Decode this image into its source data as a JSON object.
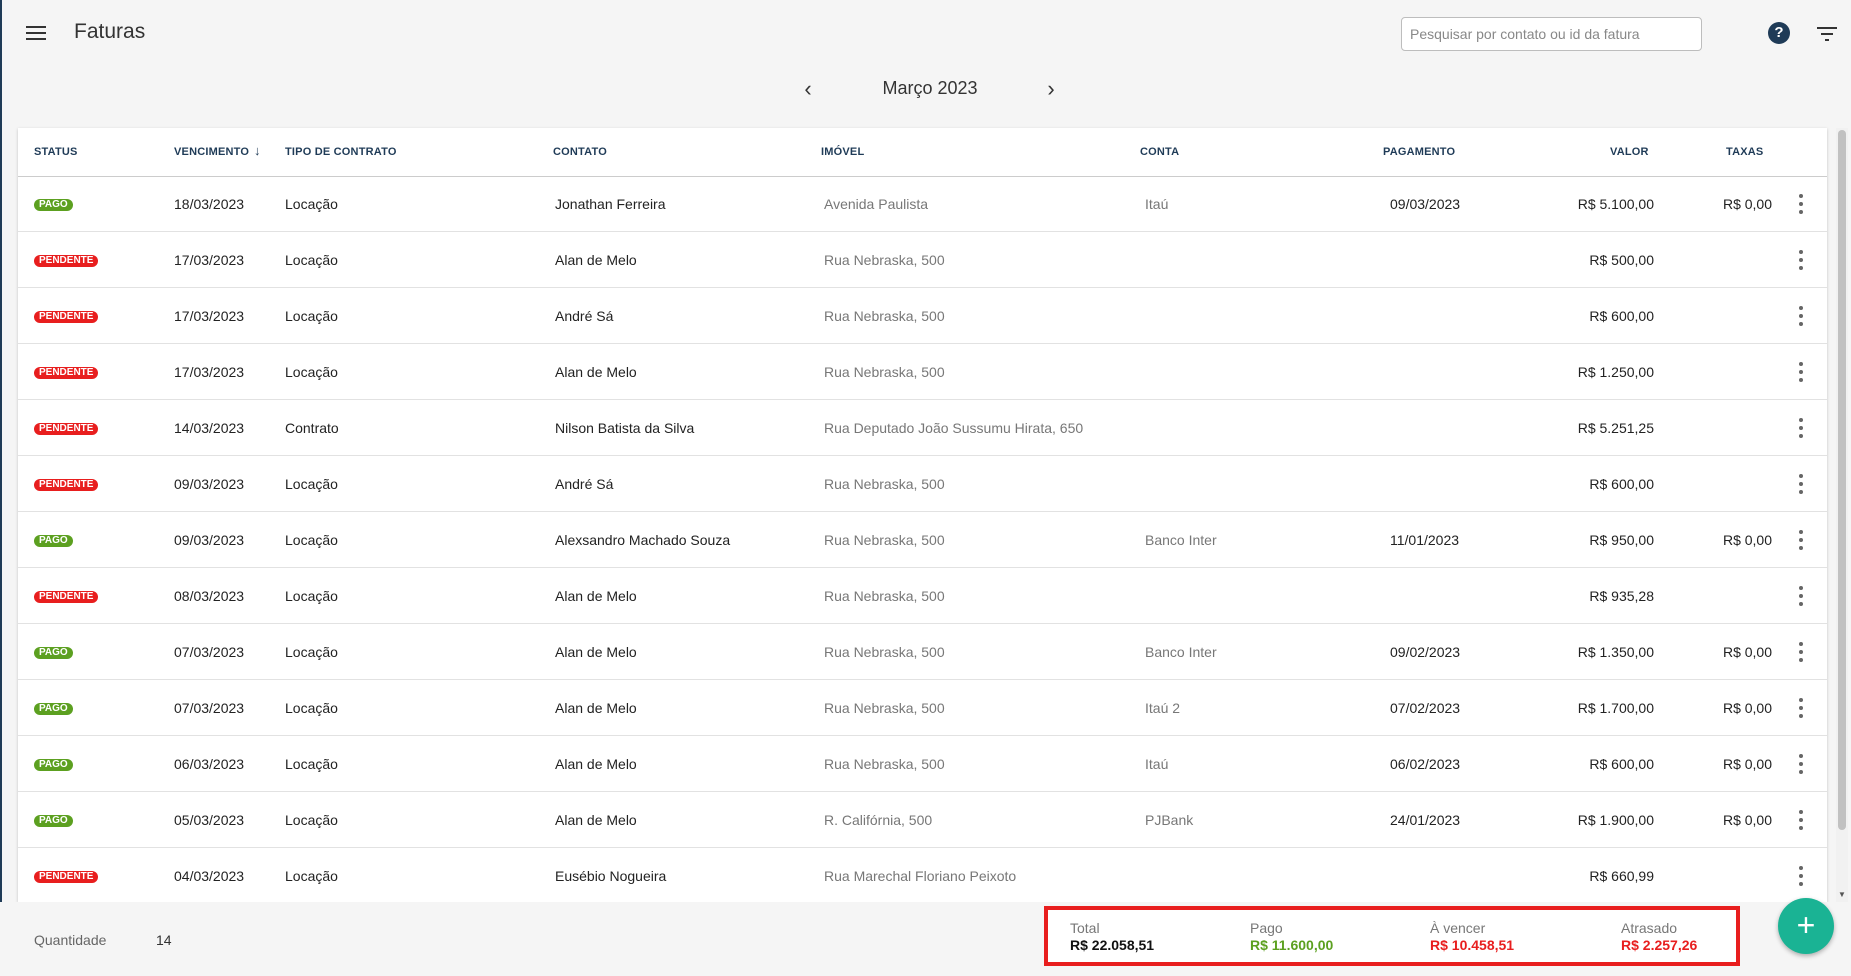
{
  "header": {
    "title": "Faturas",
    "search_placeholder": "Pesquisar por contato ou id da fatura",
    "help_icon": "help-icon",
    "filter_icon": "filter-icon"
  },
  "month_nav": {
    "label": "Março 2023",
    "prev": "‹",
    "next": "›"
  },
  "table": {
    "columns": [
      "STATUS",
      "VENCIMENTO",
      "TIPO DE CONTRATO",
      "CONTATO",
      "IMÓVEL",
      "CONTA",
      "PAGAMENTO",
      "VALOR",
      "TAXAS"
    ],
    "rows": [
      {
        "status": "PAGO",
        "vencimento": "18/03/2023",
        "tipo": "Locação",
        "contato": "Jonathan Ferreira",
        "imovel": "Avenida Paulista",
        "conta": "Itaú",
        "pagamento": "09/03/2023",
        "valor": "R$ 5.100,00",
        "taxas": "R$ 0,00"
      },
      {
        "status": "PENDENTE",
        "vencimento": "17/03/2023",
        "tipo": "Locação",
        "contato": "Alan de Melo",
        "imovel": "Rua Nebraska, 500",
        "conta": "",
        "pagamento": "",
        "valor": "R$ 500,00",
        "taxas": ""
      },
      {
        "status": "PENDENTE",
        "vencimento": "17/03/2023",
        "tipo": "Locação",
        "contato": "André Sá",
        "imovel": "Rua Nebraska, 500",
        "conta": "",
        "pagamento": "",
        "valor": "R$ 600,00",
        "taxas": ""
      },
      {
        "status": "PENDENTE",
        "vencimento": "17/03/2023",
        "tipo": "Locação",
        "contato": "Alan de Melo",
        "imovel": "Rua Nebraska, 500",
        "conta": "",
        "pagamento": "",
        "valor": "R$ 1.250,00",
        "taxas": ""
      },
      {
        "status": "PENDENTE",
        "vencimento": "14/03/2023",
        "tipo": "Contrato",
        "contato": "Nilson Batista da Silva",
        "imovel": "Rua Deputado João Sussumu Hirata, 650",
        "conta": "",
        "pagamento": "",
        "valor": "R$ 5.251,25",
        "taxas": ""
      },
      {
        "status": "PENDENTE",
        "vencimento": "09/03/2023",
        "tipo": "Locação",
        "contato": "André Sá",
        "imovel": "Rua Nebraska, 500",
        "conta": "",
        "pagamento": "",
        "valor": "R$ 600,00",
        "taxas": ""
      },
      {
        "status": "PAGO",
        "vencimento": "09/03/2023",
        "tipo": "Locação",
        "contato": "Alexsandro Machado Souza",
        "imovel": "Rua Nebraska, 500",
        "conta": "Banco Inter",
        "pagamento": "11/01/2023",
        "valor": "R$ 950,00",
        "taxas": "R$ 0,00"
      },
      {
        "status": "PENDENTE",
        "vencimento": "08/03/2023",
        "tipo": "Locação",
        "contato": "Alan de Melo",
        "imovel": "Rua Nebraska, 500",
        "conta": "",
        "pagamento": "",
        "valor": "R$ 935,28",
        "taxas": ""
      },
      {
        "status": "PAGO",
        "vencimento": "07/03/2023",
        "tipo": "Locação",
        "contato": "Alan de Melo",
        "imovel": "Rua Nebraska, 500",
        "conta": "Banco Inter",
        "pagamento": "09/02/2023",
        "valor": "R$ 1.350,00",
        "taxas": "R$ 0,00"
      },
      {
        "status": "PAGO",
        "vencimento": "07/03/2023",
        "tipo": "Locação",
        "contato": "Alan de Melo",
        "imovel": "Rua Nebraska, 500",
        "conta": "Itaú 2",
        "pagamento": "07/02/2023",
        "valor": "R$ 1.700,00",
        "taxas": "R$ 0,00"
      },
      {
        "status": "PAGO",
        "vencimento": "06/03/2023",
        "tipo": "Locação",
        "contato": "Alan de Melo",
        "imovel": "Rua Nebraska, 500",
        "conta": "Itaú",
        "pagamento": "06/02/2023",
        "valor": "R$ 600,00",
        "taxas": "R$ 0,00"
      },
      {
        "status": "PAGO",
        "vencimento": "05/03/2023",
        "tipo": "Locação",
        "contato": "Alan de Melo",
        "imovel": "R. Califórnia, 500",
        "conta": "PJBank",
        "pagamento": "24/01/2023",
        "valor": "R$ 1.900,00",
        "taxas": "R$ 0,00"
      },
      {
        "status": "PENDENTE",
        "vencimento": "04/03/2023",
        "tipo": "Locação",
        "contato": "Eusébio Nogueira",
        "imovel": "Rua Marechal Floriano Peixoto",
        "conta": "",
        "pagamento": "",
        "valor": "R$ 660,99",
        "taxas": ""
      }
    ]
  },
  "footer": {
    "quantity_label": "Quantidade",
    "quantity_value": "14",
    "totals": [
      {
        "label": "Total",
        "value": "R$ 22.058,51",
        "color": "#111111"
      },
      {
        "label": "Pago",
        "value": "R$ 11.600,00",
        "color": "#5ca020"
      },
      {
        "label": "À vencer",
        "value": "R$ 10.458,51",
        "color": "#e81e1e"
      },
      {
        "label": "Atrasado",
        "value": "R$ 2.257,26",
        "color": "#e81e1e"
      }
    ],
    "fab_label": "+"
  },
  "colors": {
    "accent": "#1f3b57",
    "paid": "#5ca020",
    "pending": "#e81e1e",
    "fab": "#1ab394"
  }
}
